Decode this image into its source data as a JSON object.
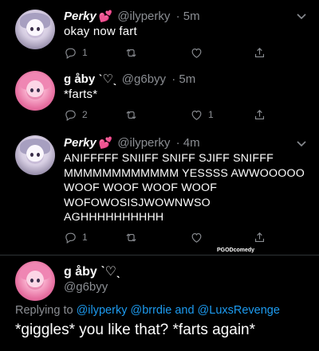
{
  "tweets": [
    {
      "name": "Perky",
      "name_badge": "💕",
      "handle": "@ilyperky",
      "time": "· 5m",
      "text": "okay now fart",
      "reply_count": "1",
      "retweet_count": "",
      "like_count": ""
    },
    {
      "name": "g åby ˋ♡ˎ",
      "handle": "@g6byy",
      "time": "· 5m",
      "text": "*farts*",
      "reply_count": "2",
      "retweet_count": "",
      "like_count": "1"
    },
    {
      "name": "Perky",
      "name_badge": "💕",
      "handle": "@ilyperky",
      "time": "· 4m",
      "text": "ANIFFFFF SNIIFF SNIFF SJIFF SNIFFF\nMMMMMMMMMMMM YESSSS AWWOOOOO\nWOOF WOOF WOOF WOOF\nWOFOWOSISJWOWNWSO\nAGHHHHHHHHHH",
      "reply_count": "1",
      "retweet_count": "",
      "like_count": ""
    }
  ],
  "watermark": "PGODcomedy",
  "focused": {
    "name": "g åby ˋ♡ˎ",
    "handle": "@g6byy",
    "replying_prefix": "Replying to",
    "mention_1": "@ilyperky",
    "mention_2": "@brrdie",
    "and_word": "and",
    "mention_3": "@LuxsRevenge",
    "text": "*giggles* you like that? *farts again*"
  },
  "icons": [
    "reply-icon",
    "retweet-icon",
    "like-icon",
    "share-icon",
    "chevron-down-icon"
  ],
  "colors": {
    "background": "#000000",
    "secondary": "#8b8e93",
    "link": "#1d9bf0",
    "badge": "#e860a8"
  }
}
